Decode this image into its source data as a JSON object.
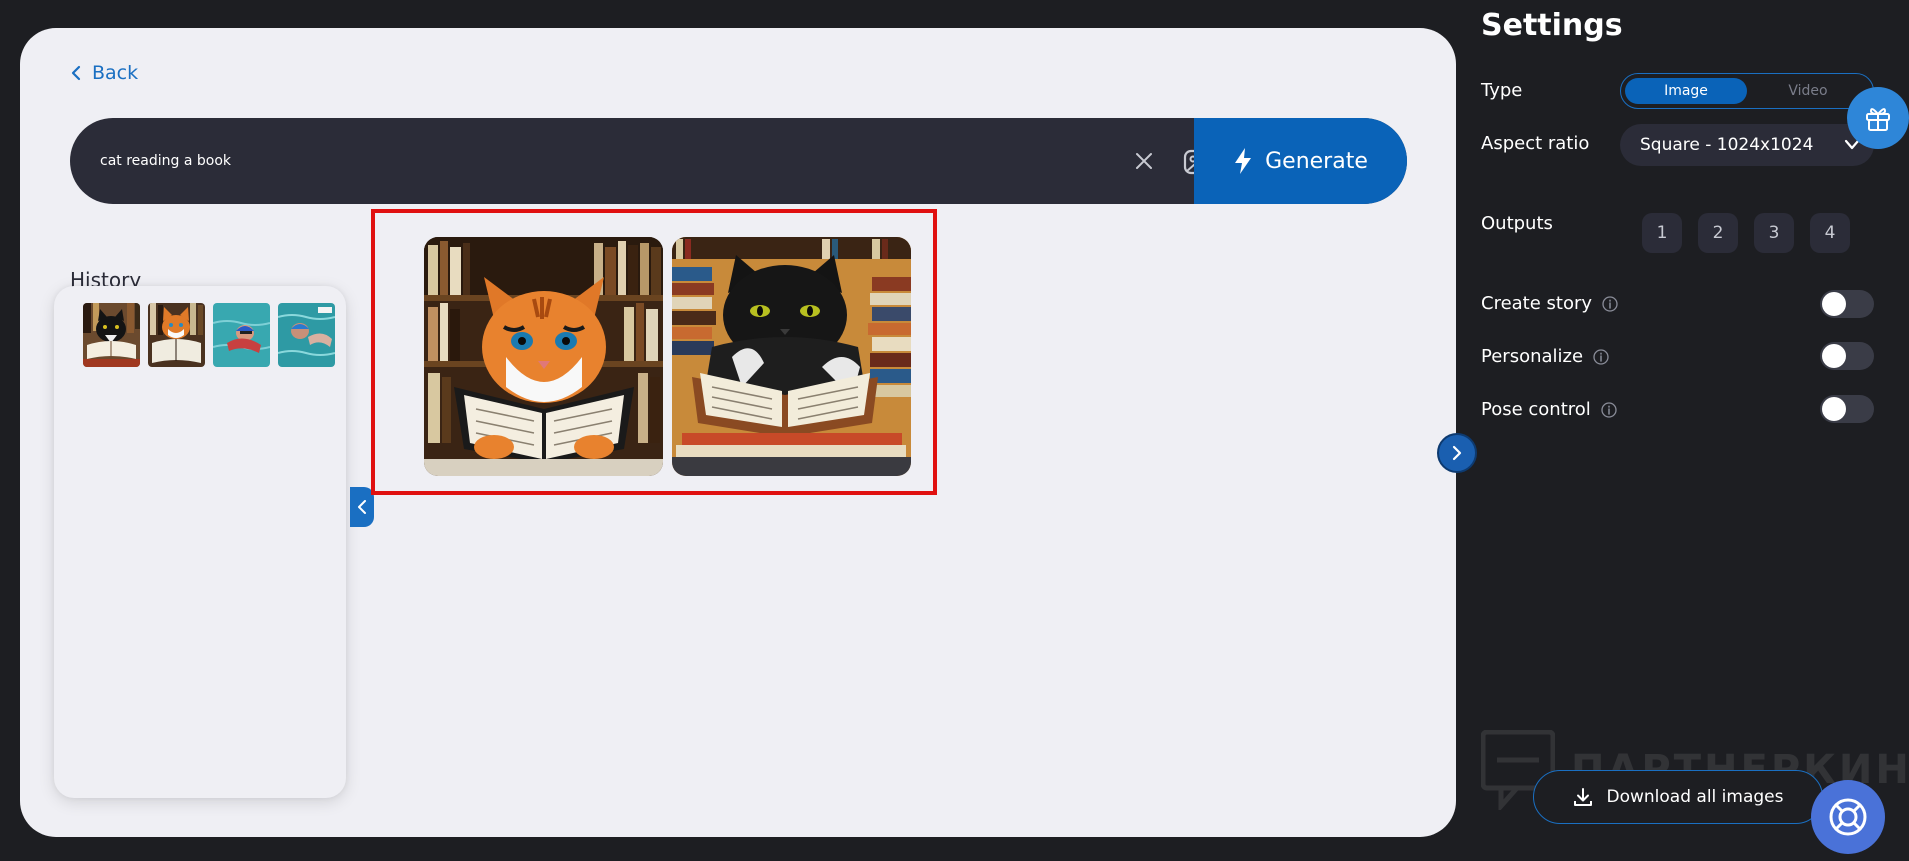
{
  "nav": {
    "back_label": "Back"
  },
  "prompt": {
    "value": "cat reading a book",
    "clear_icon": "close-icon",
    "upload_icon": "image-upload-icon",
    "generate_label": "Generate",
    "generate_icon": "lightning-icon"
  },
  "history": {
    "title": "History",
    "thumbnails": [
      "black-cat-reading",
      "orange-cat-reading",
      "swimmer-pool",
      "swimmer-pool-2"
    ]
  },
  "results": {
    "images": [
      "orange-cat-reading-book",
      "black-cat-reading-book"
    ]
  },
  "settings": {
    "title": "Settings",
    "type_label": "Type",
    "type_options": [
      "Image",
      "Video"
    ],
    "type_selected": "Image",
    "aspect_label": "Aspect ratio",
    "aspect_value": "Square - 1024x1024",
    "outputs_label": "Outputs",
    "outputs_options": [
      "1",
      "2",
      "3",
      "4"
    ],
    "toggles": [
      {
        "label": "Create story",
        "on": false
      },
      {
        "label": "Personalize",
        "on": false
      },
      {
        "label": "Pose control",
        "on": false
      }
    ],
    "download_label": "Download all images",
    "watermark": "ПАРТНЕРКИН"
  },
  "colors": {
    "accent": "#0a63b8",
    "background": "#1d1e22",
    "panel": "#efeff4",
    "highlight": "#e01010"
  }
}
